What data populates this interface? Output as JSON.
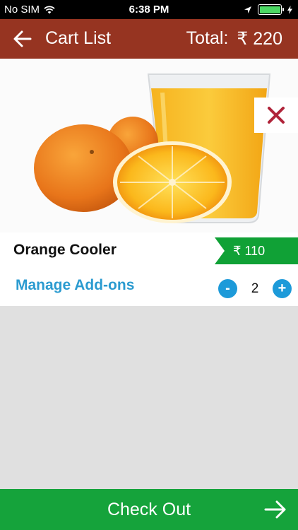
{
  "status_bar": {
    "carrier": "No SIM",
    "time": "6:38 PM",
    "battery_level": 1.0
  },
  "header": {
    "title": "Cart List",
    "total_label": "Total:",
    "total_value": "₹ 220"
  },
  "item": {
    "name": "Orange Cooler",
    "price": "₹ 110",
    "addons_label": "Manage Add-ons",
    "quantity": "2",
    "decrement_symbol": "-",
    "increment_symbol": "+"
  },
  "footer": {
    "checkout_label": "Check Out"
  },
  "colors": {
    "header": "#963421",
    "price_tag": "#10a136",
    "link": "#2b9bd0",
    "stepper": "#1d9ad9",
    "checkout": "#15a33b",
    "remove_x": "#b0243a"
  }
}
